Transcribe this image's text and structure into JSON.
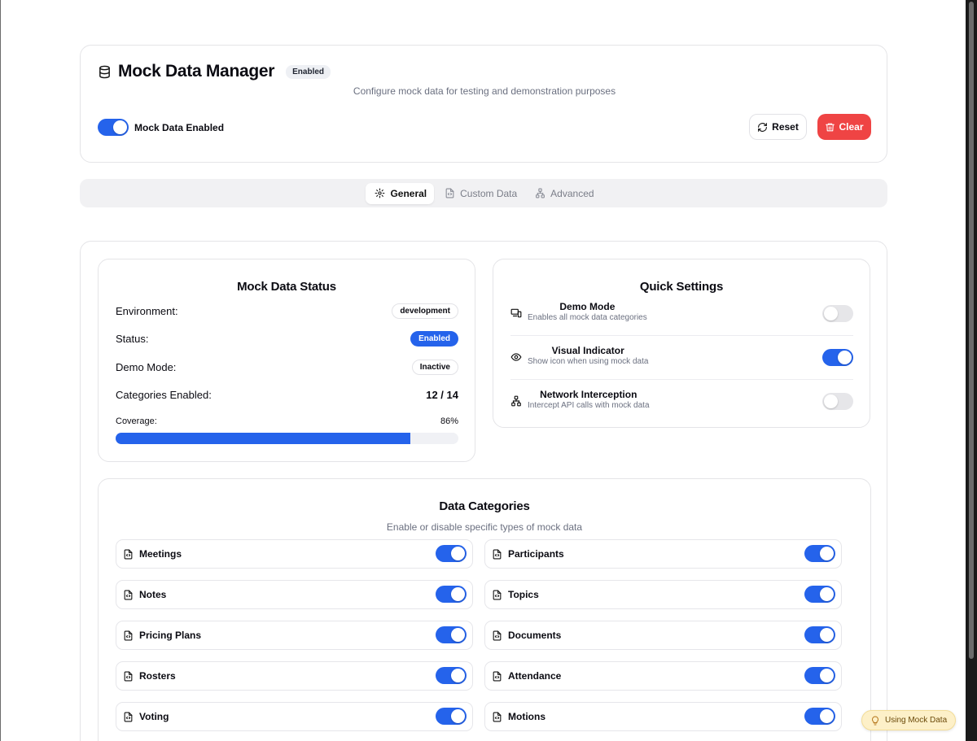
{
  "header": {
    "title": "Mock Data Manager",
    "status_badge": "Enabled",
    "subtitle": "Configure mock data for testing and demonstration purposes",
    "master_toggle_label": "Mock Data Enabled",
    "master_toggle_on": true,
    "reset_label": "Reset",
    "clear_label": "Clear"
  },
  "tabs": [
    {
      "label": "General",
      "icon": "gear-icon",
      "active": true
    },
    {
      "label": "Custom Data",
      "icon": "file-code-icon",
      "active": false
    },
    {
      "label": "Advanced",
      "icon": "network-icon",
      "active": false
    }
  ],
  "status": {
    "title": "Mock Data Status",
    "environment_label": "Environment:",
    "environment_value": "development",
    "status_label": "Status:",
    "status_value": "Enabled",
    "demo_label": "Demo Mode:",
    "demo_value": "Inactive",
    "categories_label": "Categories Enabled:",
    "categories_value": "12 / 14",
    "coverage_label": "Coverage:",
    "coverage_value": "86%",
    "coverage_fraction": 0.86
  },
  "quick": {
    "title": "Quick Settings",
    "items": [
      {
        "title": "Demo Mode",
        "desc": "Enables all mock data categories",
        "icon": "devices-icon",
        "on": false
      },
      {
        "title": "Visual Indicator",
        "desc": "Show icon when using mock data",
        "icon": "eye-icon",
        "on": true
      },
      {
        "title": "Network Interception",
        "desc": "Intercept API calls with mock data",
        "icon": "network-icon",
        "on": false
      }
    ]
  },
  "categories": {
    "title": "Data Categories",
    "subtitle": "Enable or disable specific types of mock data",
    "items": [
      {
        "label": "Meetings",
        "on": true
      },
      {
        "label": "Participants",
        "on": true
      },
      {
        "label": "Notes",
        "on": true
      },
      {
        "label": "Topics",
        "on": true
      },
      {
        "label": "Pricing Plans",
        "on": true
      },
      {
        "label": "Documents",
        "on": true
      },
      {
        "label": "Rosters",
        "on": true
      },
      {
        "label": "Attendance",
        "on": true
      },
      {
        "label": "Voting",
        "on": true
      },
      {
        "label": "Motions",
        "on": true
      }
    ]
  },
  "indicator": {
    "label": "Using Mock Data",
    "icon": "lightbulb-icon"
  },
  "colors": {
    "accent": "#2563eb",
    "danger": "#ef4444",
    "indicator_bg": "#fdf0c8"
  }
}
